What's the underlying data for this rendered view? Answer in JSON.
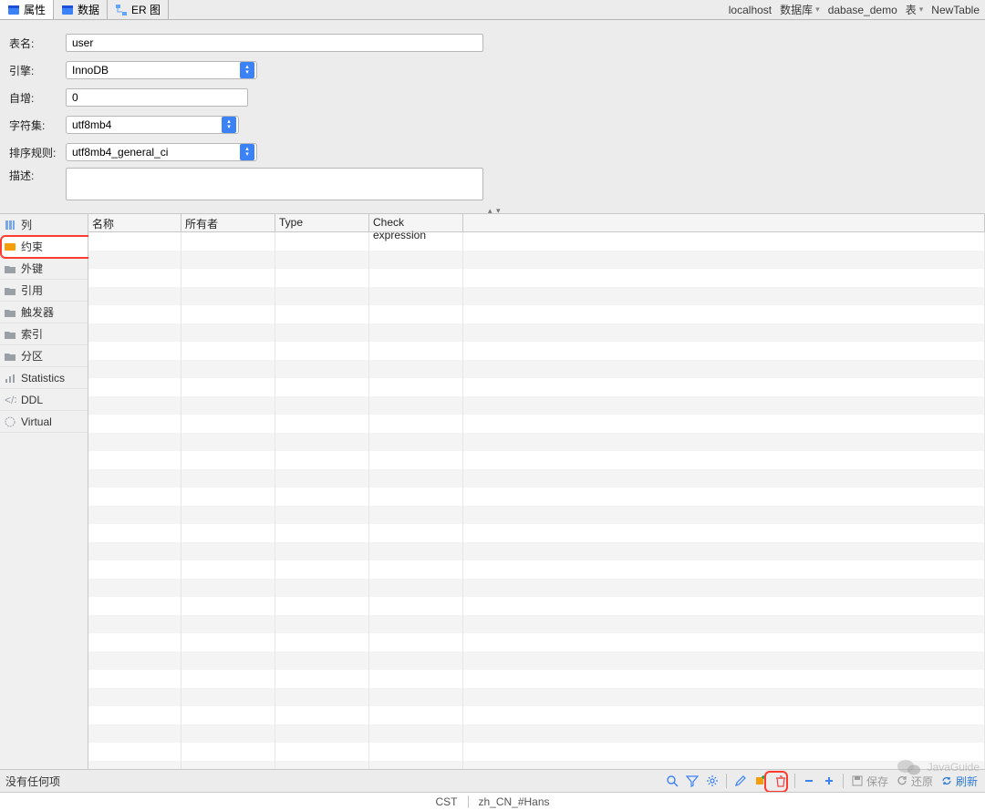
{
  "tabs": [
    {
      "label": "属性",
      "icon": "table-icon",
      "active": true
    },
    {
      "label": "数据",
      "icon": "table-icon",
      "active": false
    },
    {
      "label": "ER 图",
      "icon": "er-icon",
      "active": false
    }
  ],
  "breadcrumbs": [
    {
      "label": "localhost",
      "icon": "host-icon",
      "drop": false
    },
    {
      "label": "数据库",
      "icon": "folder-db-icon",
      "drop": true
    },
    {
      "label": "dabase_demo",
      "icon": "database-icon",
      "drop": false
    },
    {
      "label": "表",
      "icon": "folder-table-icon",
      "drop": true
    },
    {
      "label": "NewTable",
      "icon": "table-icon",
      "drop": false
    }
  ],
  "form": {
    "table_name_label": "表名:",
    "table_name_value": "user",
    "engine_label": "引擎:",
    "engine_value": "InnoDB",
    "autoinc_label": "自增:",
    "autoinc_value": "0",
    "charset_label": "字符集:",
    "charset_value": "utf8mb4",
    "collation_label": "排序规则:",
    "collation_value": "utf8mb4_general_ci",
    "description_label": "描述:",
    "description_value": ""
  },
  "side_items": [
    {
      "label": "列",
      "icon": "columns-icon"
    },
    {
      "label": "约束",
      "icon": "constraint-icon",
      "selected": true
    },
    {
      "label": "外键",
      "icon": "folder-icon"
    },
    {
      "label": "引用",
      "icon": "folder-icon"
    },
    {
      "label": "触发器",
      "icon": "folder-icon"
    },
    {
      "label": "索引",
      "icon": "folder-icon"
    },
    {
      "label": "分区",
      "icon": "folder-icon"
    },
    {
      "label": "Statistics",
      "icon": "stats-icon"
    },
    {
      "label": "DDL",
      "icon": "ddl-icon"
    },
    {
      "label": "Virtual",
      "icon": "virtual-icon"
    }
  ],
  "grid": {
    "columns": [
      "名称",
      "所有者",
      "Type",
      "Check expression"
    ]
  },
  "status": {
    "message": "没有任何项",
    "actions": {
      "save": "保存",
      "revert": "还原",
      "refresh": "刷新"
    }
  },
  "locale": {
    "tz": "CST",
    "loc": "zh_CN_#Hans"
  },
  "watermark": "JavaGuide"
}
